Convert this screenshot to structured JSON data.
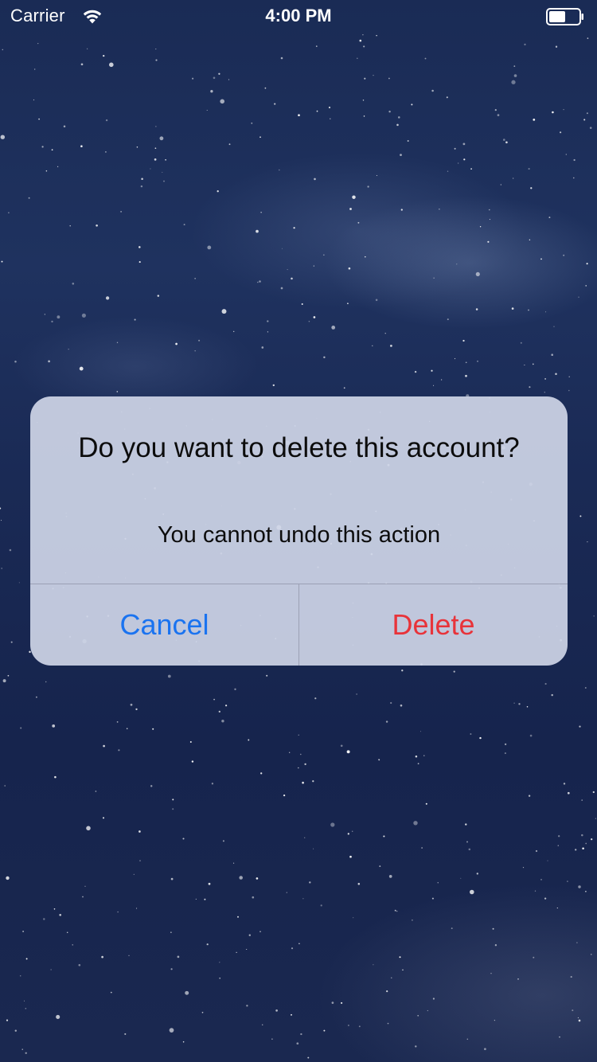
{
  "status_bar": {
    "carrier": "Carrier",
    "time": "4:00 PM",
    "wifi_icon": "wifi-icon",
    "battery_icon": "battery-icon"
  },
  "alert": {
    "title": "Do you want to delete this account?",
    "message": "You cannot undo this action",
    "cancel_label": "Cancel",
    "delete_label": "Delete"
  },
  "colors": {
    "cancel": "#1a73f0",
    "delete": "#e8333a",
    "alert_background": "#ced4e6",
    "status_text": "#ffffff"
  }
}
